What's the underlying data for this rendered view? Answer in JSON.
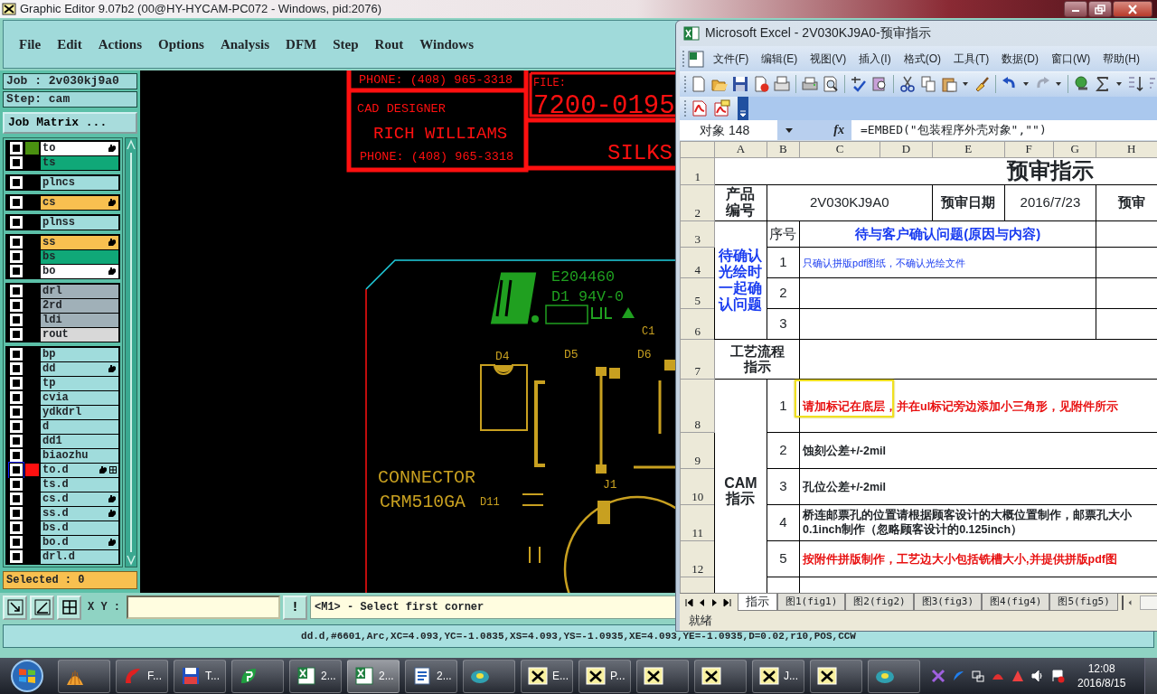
{
  "genesis": {
    "title": "Graphic Editor 9.07b2 (00@HY-HYCAM-PC072 - Windows, pid:2076)",
    "menu": [
      "File",
      "Edit",
      "Actions",
      "Options",
      "Analysis",
      "DFM",
      "Step",
      "Rout",
      "Windows"
    ],
    "job": "Job : 2v030kj9a0",
    "step": "Step: cam",
    "matrix_button": "Job Matrix ...",
    "layer_groups": [
      {
        "layers": [
          {
            "name": "to",
            "color": "#ffffff",
            "editable": true,
            "focused": false,
            "swatch": {
              "color": "#4a9010"
            }
          },
          {
            "name": "ts",
            "color": "#10a878",
            "editable": false,
            "focused": false
          }
        ]
      },
      {
        "layers": [
          {
            "name": "plncs",
            "color": "#a0dcdc",
            "editable": false,
            "focused": false
          }
        ]
      },
      {
        "layers": [
          {
            "name": "cs",
            "color": "#f8c050",
            "editable": true,
            "focused": false
          }
        ]
      },
      {
        "layers": [
          {
            "name": "plnss",
            "color": "#a0dcdc",
            "editable": false,
            "focused": false
          }
        ]
      },
      {
        "layers": [
          {
            "name": "ss",
            "color": "#f8c050",
            "editable": true,
            "focused": false
          },
          {
            "name": "bs",
            "color": "#10a878",
            "editable": false,
            "focused": false
          },
          {
            "name": "bo",
            "color": "#ffffff",
            "editable": true,
            "focused": false
          }
        ]
      },
      {
        "layers": [
          {
            "name": "drl",
            "color": "#a0b0b8",
            "editable": false,
            "focused": false
          },
          {
            "name": "2rd",
            "color": "#a0b0b8",
            "editable": false,
            "focused": false
          },
          {
            "name": "ldi",
            "color": "#a0b0b8",
            "editable": false,
            "focused": false
          },
          {
            "name": "rout",
            "color": "#d8d8d8",
            "editable": false,
            "focused": false
          }
        ]
      },
      {
        "layers": [
          {
            "name": "bp",
            "color": "#a0dcdc",
            "editable": false,
            "focused": false
          },
          {
            "name": "dd",
            "color": "#a0dcdc",
            "editable": true,
            "focused": false
          },
          {
            "name": "tp",
            "color": "#a0dcdc",
            "editable": false,
            "focused": false
          },
          {
            "name": "cvia",
            "color": "#a0dcdc",
            "editable": false,
            "focused": false
          },
          {
            "name": "ydkdrl",
            "color": "#a0dcdc",
            "editable": false,
            "focused": false
          },
          {
            "name": "d",
            "color": "#a0dcdc",
            "editable": false,
            "focused": false
          },
          {
            "name": "dd1",
            "color": "#a0dcdc",
            "editable": false,
            "focused": false
          },
          {
            "name": "biaozhu",
            "color": "#a0dcdc",
            "editable": false,
            "focused": false
          },
          {
            "name": "to.d",
            "color": "#a0dcdc",
            "editable": true,
            "focused": true,
            "swatch": {
              "color": "#ff1010"
            }
          },
          {
            "name": "ts.d",
            "color": "#a0dcdc",
            "editable": false,
            "focused": false
          },
          {
            "name": "cs.d",
            "color": "#a0dcdc",
            "editable": true,
            "focused": false
          },
          {
            "name": "ss.d",
            "color": "#a0dcdc",
            "editable": true,
            "focused": false
          },
          {
            "name": "bs.d",
            "color": "#a0dcdc",
            "editable": false,
            "focused": false
          },
          {
            "name": "bo.d",
            "color": "#a0dcdc",
            "editable": true,
            "focused": false
          },
          {
            "name": "drl.d",
            "color": "#a0dcdc",
            "editable": false,
            "focused": false
          }
        ]
      }
    ],
    "selected_count": "Selected : 0",
    "canvas": {
      "labels": [
        {
          "text": "PHONE: (408) 965-3318",
          "color": "#ff1010"
        },
        {
          "text": "FILE:",
          "color": "#ff1010"
        },
        {
          "text": "7200-0195",
          "color": "#ff1010"
        },
        {
          "text": "CAD DESIGNER",
          "color": "#ff1010"
        },
        {
          "text": "RICH WILLIAMS",
          "color": "#ff1010"
        },
        {
          "text": "PHONE: (408) 965-3318",
          "color": "#ff1010"
        },
        {
          "text": "SILKS",
          "color": "#ff1010"
        },
        {
          "text": "E204460",
          "color": "#20a020"
        },
        {
          "text": "D1 94V-0",
          "color": "#20a020"
        },
        {
          "text": "C1",
          "color": "#c8a020"
        },
        {
          "text": "D4",
          "color": "#c8a020"
        },
        {
          "text": "D5",
          "color": "#c8a020"
        },
        {
          "text": "D6",
          "color": "#c8a020"
        },
        {
          "text": "CONNECTOR",
          "color": "#c8a020"
        },
        {
          "text": "CRM510GA",
          "color": "#c8a020"
        },
        {
          "text": "D11",
          "color": "#c8a020"
        },
        {
          "text": "J1",
          "color": "#c8a020"
        }
      ]
    },
    "xy_label": "X Y :",
    "warn_button": "!",
    "prompt": "<M1> - Select first corner",
    "status_line": "dd.d,#6601,Arc,XC=4.093,YC=-1.0835,XS=4.093,YS=-1.0935,XE=4.093,YE=-1.0935,D=0.02,r10,POS,CCW"
  },
  "excel": {
    "title": "Microsoft Excel - 2V030KJ9A0-预审指示",
    "menu": [
      "文件(F)",
      "编辑(E)",
      "视图(V)",
      "插入(I)",
      "格式(O)",
      "工具(T)",
      "数据(D)",
      "窗口(W)",
      "帮助(H)"
    ],
    "name_box": "对象 148",
    "formula_button": "fx",
    "formula": "=EMBED(\"包装程序外壳对象\",\"\")",
    "columns": [
      "A",
      "B",
      "C",
      "D",
      "E",
      "F",
      "G",
      "H"
    ],
    "row_labels": [
      "1",
      "2",
      "3",
      "4",
      "5",
      "6",
      "7",
      "8",
      "9",
      "10",
      "11",
      "12"
    ],
    "rows": [
      [
        {
          "text": "预审指示",
          "kind": "title",
          "colspan": 8
        }
      ],
      [
        {
          "text": "产品编号",
          "kind": "label"
        },
        {
          "text": "2V030KJ9A0",
          "kind": "value",
          "colspan": 3
        },
        {
          "text": "预审日期",
          "kind": "label"
        },
        {
          "text": "2016/7/23",
          "kind": "value",
          "colspan": 2
        },
        {
          "text": "预审",
          "kind": "label"
        }
      ],
      [
        {
          "text": "待确认光绘时一起确认问题",
          "kind": "blue-heading",
          "rowspan": 4
        },
        {
          "text": "序号",
          "kind": "number"
        },
        {
          "text": "待与客户确认问题(原因与内容)",
          "kind": "blue-heading",
          "colspan": 5
        },
        {}
      ],
      [
        {
          "text": "1",
          "kind": "number"
        },
        {
          "text": "只确认拼版pdf图纸，不确认光绘文件",
          "kind": "blue",
          "colspan": 5
        },
        {}
      ],
      [
        {
          "text": "2",
          "kind": "number"
        },
        {
          "colspan": 5
        },
        {}
      ],
      [
        {
          "text": "3",
          "kind": "number"
        },
        {
          "colspan": 5
        },
        {}
      ],
      [
        {
          "text": "工艺流程指示",
          "kind": "label",
          "colspan": 2
        },
        {
          "colspan": 6
        }
      ],
      [
        {
          "text": "CAM指示",
          "kind": "label",
          "rowspan": 6
        },
        {
          "text": "1",
          "kind": "number"
        },
        {
          "text": "请加标记在底层，并在ul标记旁边添加小三角形，见附件所示",
          "kind": "red",
          "colspan": 6
        }
      ],
      [
        {
          "text": "2",
          "kind": "number"
        },
        {
          "text": "蚀刻公差+/-2mil",
          "kind": "bold",
          "colspan": 6
        }
      ],
      [
        {
          "text": "3",
          "kind": "number"
        },
        {
          "text": "孔位公差+/-2mil",
          "kind": "bold",
          "colspan": 6
        }
      ],
      [
        {
          "text": "4",
          "kind": "number"
        },
        {
          "text": "桥连邮票孔的位置请根据顾客设计的大概位置制作，邮票孔大小\n0.1inch制作（忽略顾客设计的0.125inch）",
          "kind": "bold",
          "colspan": 6
        }
      ],
      [
        {
          "text": "5",
          "kind": "number"
        },
        {
          "text": "按附件拼版制作，工艺边大小包括铣槽大小,并提供拼版pdf图",
          "kind": "red",
          "colspan": 6
        }
      ],
      [
        {},
        {
          "colspan": 6
        }
      ]
    ],
    "sheet_tabs": [
      {
        "label": "指示",
        "selected": true
      },
      {
        "label": "图1(fig1)",
        "selected": false
      },
      {
        "label": "图2(fig2)",
        "selected": false
      },
      {
        "label": "图3(fig3)",
        "selected": false
      },
      {
        "label": "图4(fig4)",
        "selected": false
      },
      {
        "label": "图5(fig5)",
        "selected": false
      }
    ],
    "status": "就绪"
  },
  "taskbar": {
    "buttons": [
      {
        "selected": false
      },
      {
        "label": "F...",
        "selected": false
      },
      {
        "label": "T...",
        "selected": false
      },
      {
        "selected": false
      },
      {
        "label": "2...",
        "selected": false
      },
      {
        "label": "2...",
        "selected": true
      },
      {
        "label": "2...",
        "selected": false
      },
      {
        "selected": false
      },
      {
        "label": "E...",
        "selected": false
      },
      {
        "label": "P...",
        "selected": false
      },
      {
        "selected": false
      },
      {
        "selected": false
      },
      {
        "label": "J...",
        "selected": false
      },
      {
        "selected": false
      },
      {
        "selected": false
      }
    ],
    "time": "12:08",
    "date": "2016/8/15"
  }
}
